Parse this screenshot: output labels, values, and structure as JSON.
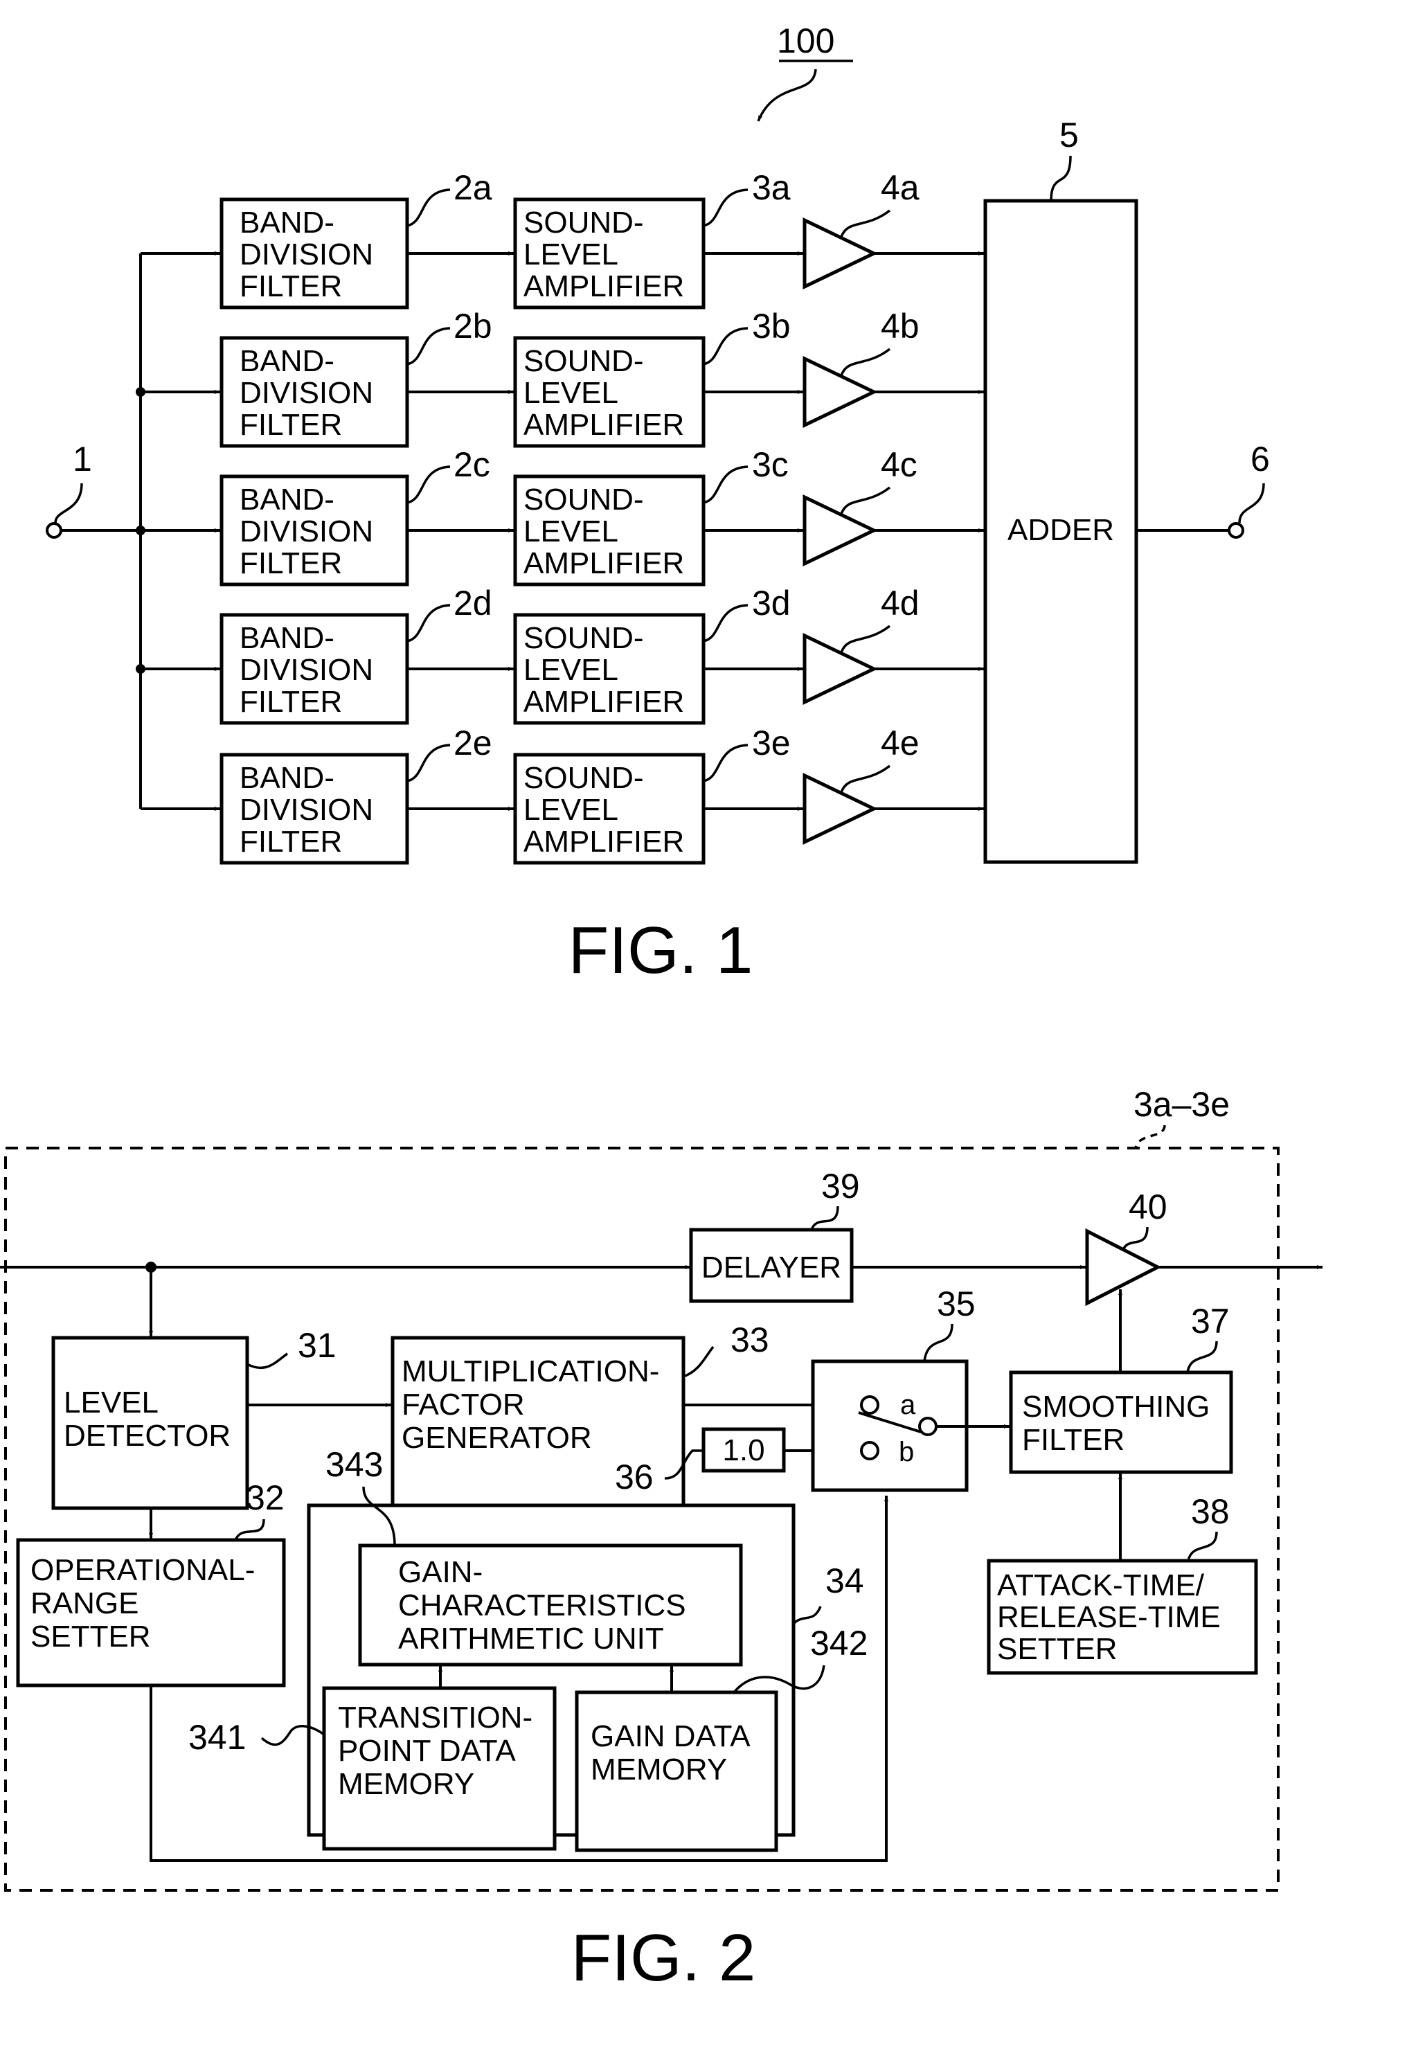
{
  "fig1": {
    "title": "FIG. 1",
    "system_ref": "100",
    "input_ref": "1",
    "output_ref": "6",
    "adder": {
      "ref": "5",
      "label": "ADDER"
    },
    "channels": [
      {
        "filter_ref": "2a",
        "amp_ref": "3a",
        "gain_ref": "4a"
      },
      {
        "filter_ref": "2b",
        "amp_ref": "3b",
        "gain_ref": "4b"
      },
      {
        "filter_ref": "2c",
        "amp_ref": "3c",
        "gain_ref": "4c"
      },
      {
        "filter_ref": "2d",
        "amp_ref": "3d",
        "gain_ref": "4d"
      },
      {
        "filter_ref": "2e",
        "amp_ref": "3e",
        "gain_ref": "4e"
      }
    ],
    "filter_label": [
      "BAND-",
      "DIVISION",
      "FILTER"
    ],
    "amp_label": [
      "SOUND-",
      "LEVEL",
      "AMPLIFIER"
    ]
  },
  "fig2": {
    "title": "FIG. 2",
    "boundary_ref": "3a–3e",
    "level_detector": {
      "ref": "31",
      "label": [
        "LEVEL",
        "DETECTOR"
      ]
    },
    "range_setter": {
      "ref": "32",
      "label": [
        "OPERATIONAL-",
        "RANGE",
        "SETTER"
      ]
    },
    "mult_gen": {
      "ref": "33",
      "label": [
        "MULTIPLICATION-",
        "FACTOR",
        "GENERATOR"
      ]
    },
    "gain_block": {
      "ref": "34"
    },
    "gain_arith": {
      "ref": "343",
      "label": [
        "GAIN-",
        "CHARACTERISTICS",
        "ARITHMETIC UNIT"
      ]
    },
    "transition_mem": {
      "ref": "341",
      "label": [
        "TRANSITION-",
        "POINT DATA",
        "MEMORY"
      ]
    },
    "gain_mem": {
      "ref": "342",
      "label": [
        "GAIN DATA",
        "MEMORY"
      ]
    },
    "switch": {
      "ref": "35",
      "terminal_a": "a",
      "terminal_b": "b"
    },
    "constant": {
      "ref": "36",
      "label": "1.0"
    },
    "smoothing": {
      "ref": "37",
      "label": [
        "SMOOTHING",
        "FILTER"
      ]
    },
    "attack_release": {
      "ref": "38",
      "label": [
        "ATTACK-TIME/",
        "RELEASE-TIME",
        "SETTER"
      ]
    },
    "delayer": {
      "ref": "39",
      "label": "DELAYER"
    },
    "multiplier": {
      "ref": "40"
    }
  }
}
